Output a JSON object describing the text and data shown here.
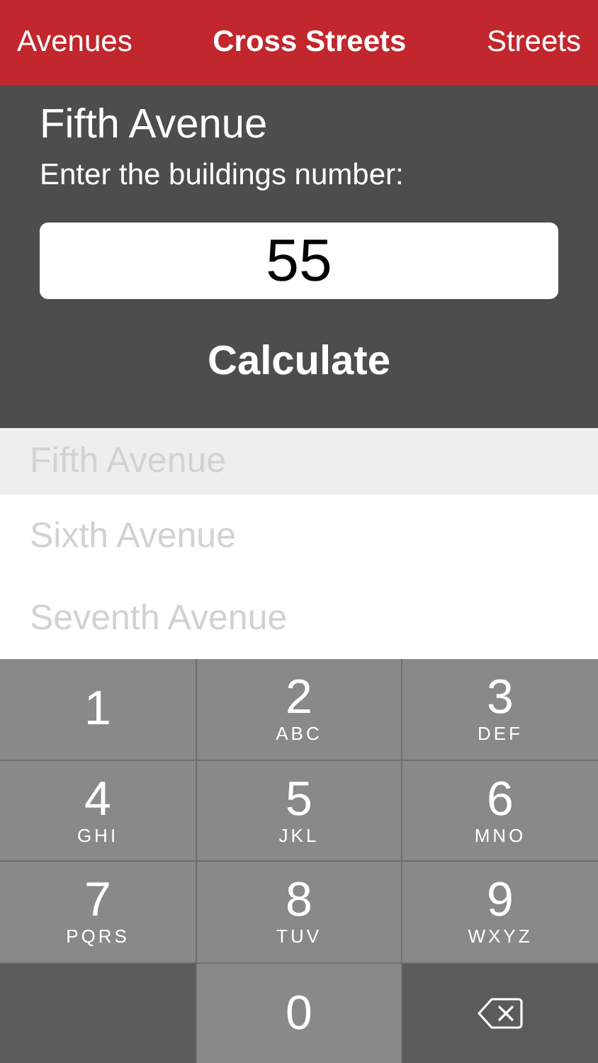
{
  "tabs": [
    {
      "label": "Avenues",
      "selected": false
    },
    {
      "label": "Cross Streets",
      "selected": true
    },
    {
      "label": "Streets",
      "selected": false
    }
  ],
  "list": [
    {
      "name": "Fifth Avenue",
      "selected": true
    },
    {
      "name": "Sixth Avenue",
      "selected": false
    },
    {
      "name": "Seventh Avenue",
      "selected": false
    }
  ],
  "dialog": {
    "title": "Fifth Avenue",
    "prompt": "Enter the buildings number:",
    "value": "55",
    "button": "Calculate"
  },
  "keypad": [
    {
      "kind": "digit",
      "digit": "1"
    },
    {
      "kind": "digit",
      "digit": "2",
      "letters": "ABC"
    },
    {
      "kind": "digit",
      "digit": "3",
      "letters": "DEF"
    },
    {
      "kind": "digit",
      "digit": "4",
      "letters": "GHI"
    },
    {
      "kind": "digit",
      "digit": "5",
      "letters": "JKL"
    },
    {
      "kind": "digit",
      "digit": "6",
      "letters": "MNO"
    },
    {
      "kind": "digit",
      "digit": "7",
      "letters": "PQRS"
    },
    {
      "kind": "digit",
      "digit": "8",
      "letters": "TUV"
    },
    {
      "kind": "digit",
      "digit": "9",
      "letters": "WXYZ"
    },
    {
      "kind": "blank"
    },
    {
      "kind": "digit",
      "digit": "0"
    },
    {
      "kind": "delete"
    }
  ]
}
